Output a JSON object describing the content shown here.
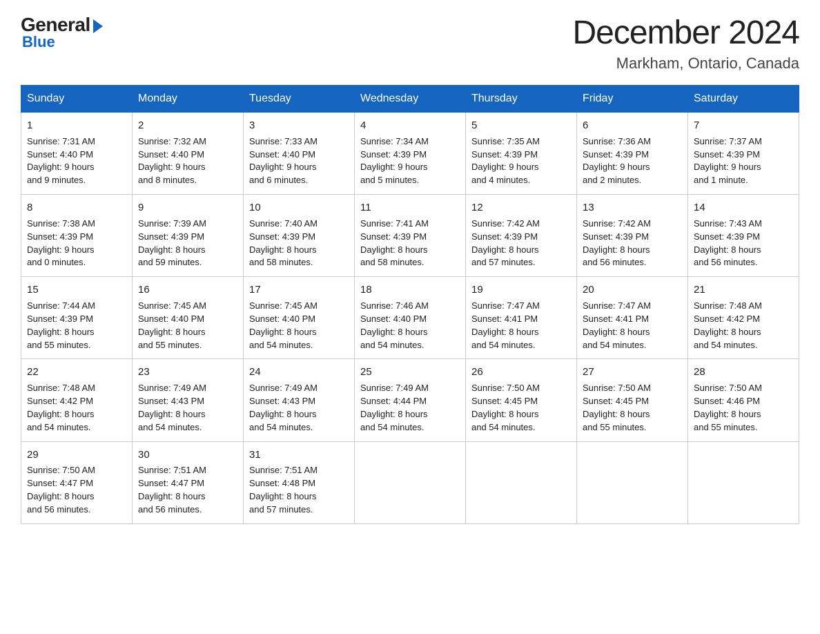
{
  "logo": {
    "general": "General",
    "blue": "Blue"
  },
  "header": {
    "title": "December 2024",
    "subtitle": "Markham, Ontario, Canada"
  },
  "days_of_week": [
    "Sunday",
    "Monday",
    "Tuesday",
    "Wednesday",
    "Thursday",
    "Friday",
    "Saturday"
  ],
  "weeks": [
    [
      {
        "day": "1",
        "sunrise": "7:31 AM",
        "sunset": "4:40 PM",
        "daylight": "9 hours and 9 minutes."
      },
      {
        "day": "2",
        "sunrise": "7:32 AM",
        "sunset": "4:40 PM",
        "daylight": "9 hours and 8 minutes."
      },
      {
        "day": "3",
        "sunrise": "7:33 AM",
        "sunset": "4:40 PM",
        "daylight": "9 hours and 6 minutes."
      },
      {
        "day": "4",
        "sunrise": "7:34 AM",
        "sunset": "4:39 PM",
        "daylight": "9 hours and 5 minutes."
      },
      {
        "day": "5",
        "sunrise": "7:35 AM",
        "sunset": "4:39 PM",
        "daylight": "9 hours and 4 minutes."
      },
      {
        "day": "6",
        "sunrise": "7:36 AM",
        "sunset": "4:39 PM",
        "daylight": "9 hours and 2 minutes."
      },
      {
        "day": "7",
        "sunrise": "7:37 AM",
        "sunset": "4:39 PM",
        "daylight": "9 hours and 1 minute."
      }
    ],
    [
      {
        "day": "8",
        "sunrise": "7:38 AM",
        "sunset": "4:39 PM",
        "daylight": "9 hours and 0 minutes."
      },
      {
        "day": "9",
        "sunrise": "7:39 AM",
        "sunset": "4:39 PM",
        "daylight": "8 hours and 59 minutes."
      },
      {
        "day": "10",
        "sunrise": "7:40 AM",
        "sunset": "4:39 PM",
        "daylight": "8 hours and 58 minutes."
      },
      {
        "day": "11",
        "sunrise": "7:41 AM",
        "sunset": "4:39 PM",
        "daylight": "8 hours and 58 minutes."
      },
      {
        "day": "12",
        "sunrise": "7:42 AM",
        "sunset": "4:39 PM",
        "daylight": "8 hours and 57 minutes."
      },
      {
        "day": "13",
        "sunrise": "7:42 AM",
        "sunset": "4:39 PM",
        "daylight": "8 hours and 56 minutes."
      },
      {
        "day": "14",
        "sunrise": "7:43 AM",
        "sunset": "4:39 PM",
        "daylight": "8 hours and 56 minutes."
      }
    ],
    [
      {
        "day": "15",
        "sunrise": "7:44 AM",
        "sunset": "4:39 PM",
        "daylight": "8 hours and 55 minutes."
      },
      {
        "day": "16",
        "sunrise": "7:45 AM",
        "sunset": "4:40 PM",
        "daylight": "8 hours and 55 minutes."
      },
      {
        "day": "17",
        "sunrise": "7:45 AM",
        "sunset": "4:40 PM",
        "daylight": "8 hours and 54 minutes."
      },
      {
        "day": "18",
        "sunrise": "7:46 AM",
        "sunset": "4:40 PM",
        "daylight": "8 hours and 54 minutes."
      },
      {
        "day": "19",
        "sunrise": "7:47 AM",
        "sunset": "4:41 PM",
        "daylight": "8 hours and 54 minutes."
      },
      {
        "day": "20",
        "sunrise": "7:47 AM",
        "sunset": "4:41 PM",
        "daylight": "8 hours and 54 minutes."
      },
      {
        "day": "21",
        "sunrise": "7:48 AM",
        "sunset": "4:42 PM",
        "daylight": "8 hours and 54 minutes."
      }
    ],
    [
      {
        "day": "22",
        "sunrise": "7:48 AM",
        "sunset": "4:42 PM",
        "daylight": "8 hours and 54 minutes."
      },
      {
        "day": "23",
        "sunrise": "7:49 AM",
        "sunset": "4:43 PM",
        "daylight": "8 hours and 54 minutes."
      },
      {
        "day": "24",
        "sunrise": "7:49 AM",
        "sunset": "4:43 PM",
        "daylight": "8 hours and 54 minutes."
      },
      {
        "day": "25",
        "sunrise": "7:49 AM",
        "sunset": "4:44 PM",
        "daylight": "8 hours and 54 minutes."
      },
      {
        "day": "26",
        "sunrise": "7:50 AM",
        "sunset": "4:45 PM",
        "daylight": "8 hours and 54 minutes."
      },
      {
        "day": "27",
        "sunrise": "7:50 AM",
        "sunset": "4:45 PM",
        "daylight": "8 hours and 55 minutes."
      },
      {
        "day": "28",
        "sunrise": "7:50 AM",
        "sunset": "4:46 PM",
        "daylight": "8 hours and 55 minutes."
      }
    ],
    [
      {
        "day": "29",
        "sunrise": "7:50 AM",
        "sunset": "4:47 PM",
        "daylight": "8 hours and 56 minutes."
      },
      {
        "day": "30",
        "sunrise": "7:51 AM",
        "sunset": "4:47 PM",
        "daylight": "8 hours and 56 minutes."
      },
      {
        "day": "31",
        "sunrise": "7:51 AM",
        "sunset": "4:48 PM",
        "daylight": "8 hours and 57 minutes."
      },
      null,
      null,
      null,
      null
    ]
  ]
}
